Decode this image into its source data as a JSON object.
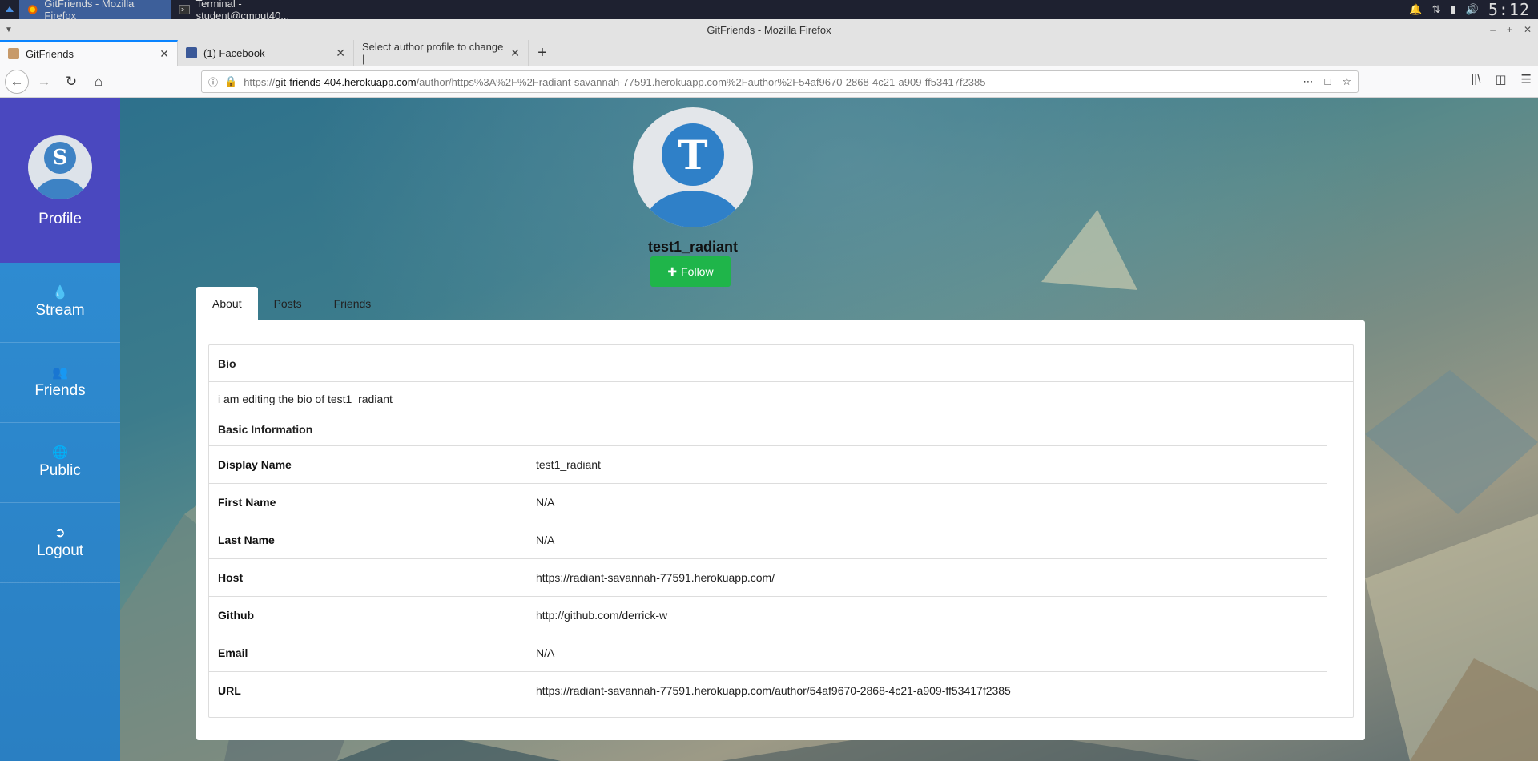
{
  "taskbar": {
    "tasks": [
      {
        "label": "GitFriends - Mozilla Firefox"
      },
      {
        "label": "Terminal - student@cmput40..."
      }
    ],
    "clock": "5:12"
  },
  "window": {
    "title": "GitFriends - Mozilla Firefox"
  },
  "tabs": [
    {
      "label": "GitFriends"
    },
    {
      "label": "(1) Facebook"
    },
    {
      "label": "Select author profile to change |"
    }
  ],
  "urlbar": {
    "scheme": "https://",
    "host": "git-friends-404.herokuapp.com",
    "path": "/author/https%3A%2F%2Fradiant-savannah-77591.herokuapp.com%2Fauthor%2F54af9670-2868-4c21-a909-ff53417f2385"
  },
  "sidebar": {
    "profile": {
      "initial": "S",
      "label": "Profile"
    },
    "items": [
      {
        "label": "Stream",
        "icon": "tint-icon"
      },
      {
        "label": "Friends",
        "icon": "users-icon"
      },
      {
        "label": "Public",
        "icon": "globe-icon"
      },
      {
        "label": "Logout",
        "icon": "sign-out-icon"
      }
    ]
  },
  "profile": {
    "initial": "T",
    "username": "test1_radiant",
    "follow_label": "Follow"
  },
  "page_tabs": [
    {
      "label": "About"
    },
    {
      "label": "Posts"
    },
    {
      "label": "Friends"
    }
  ],
  "about": {
    "bio_heading": "Bio",
    "bio_text": "i am editing the bio of test1_radiant",
    "basic_heading": "Basic Information",
    "rows": [
      {
        "key": "Display Name",
        "value": "test1_radiant"
      },
      {
        "key": "First Name",
        "value": "N/A"
      },
      {
        "key": "Last Name",
        "value": "N/A"
      },
      {
        "key": "Host",
        "value": "https://radiant-savannah-77591.herokuapp.com/"
      },
      {
        "key": "Github",
        "value": "http://github.com/derrick-w"
      },
      {
        "key": "Email",
        "value": "N/A"
      },
      {
        "key": "URL",
        "value": "https://radiant-savannah-77591.herokuapp.com/author/54af9670-2868-4c21-a909-ff53417f2385"
      }
    ]
  },
  "colors": {
    "sidebar_profile": "#4a48bf",
    "sidebar": "#2f8fd6",
    "follow": "#1fb54a",
    "avatar": "#2f80c8"
  }
}
